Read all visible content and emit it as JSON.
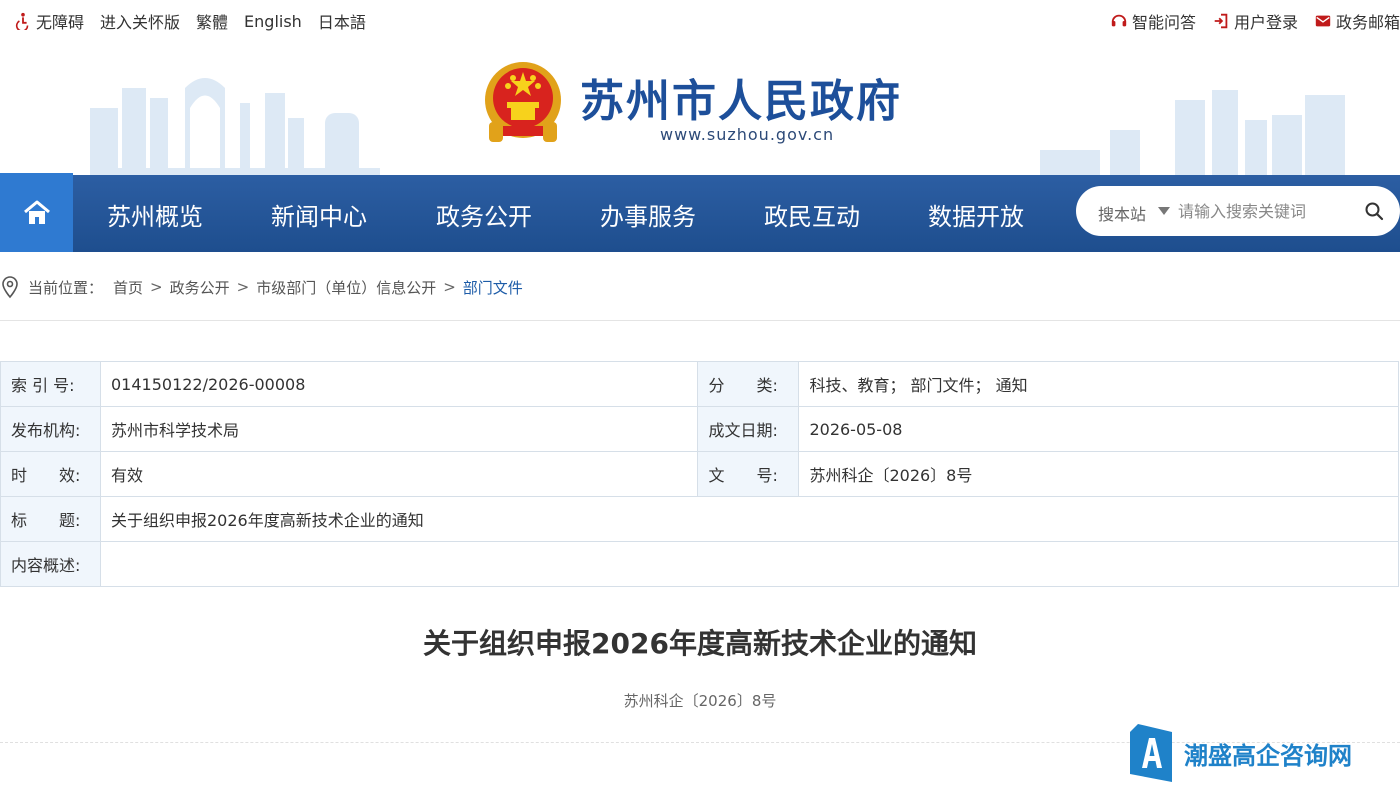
{
  "topbar": {
    "accessibility": "无障碍",
    "elder_mode": "进入关怀版",
    "traditional": "繁體",
    "english": "English",
    "japanese": "日本語",
    "smart_qa": "智能问答",
    "login": "用户登录",
    "mail": "政务邮箱"
  },
  "header": {
    "site_title": "苏州市人民政府",
    "site_url": "www.suzhou.gov.cn"
  },
  "nav": {
    "items": [
      "苏州概览",
      "新闻中心",
      "政务公开",
      "办事服务",
      "政民互动",
      "数据开放"
    ],
    "search_scope": "搜本站",
    "search_placeholder": "请输入搜索关键词"
  },
  "breadcrumb": {
    "label": "当前位置：",
    "items": [
      "首页",
      "政务公开",
      "市级部门（单位）信息公开",
      "部门文件"
    ],
    "separator": ">"
  },
  "meta": {
    "index_key": "索 引 号:",
    "index_val": "014150122/2026-00008",
    "category_key": "分　　类:",
    "category_val": "科技、教育；  部门文件；  通知",
    "publisher_key": "发布机构:",
    "publisher_val": "苏州市科学技术局",
    "date_key": "成文日期:",
    "date_val": "2026-05-08",
    "validity_key": "时　　效:",
    "validity_val": "有效",
    "docno_key": "文　　号:",
    "docno_val": "苏州科企〔2026〕8号",
    "title_key": "标　　题:",
    "title_val": "关于组织申报2026年度高新技术企业的通知",
    "summary_key": "内容概述:",
    "summary_val": ""
  },
  "article": {
    "title": "关于组织申报2026年度高新技术企业的通知",
    "doc_number": "苏州科企〔2026〕8号"
  },
  "watermark": {
    "text": "潮盛高企咨询网"
  },
  "colors": {
    "nav_bg": "#2457a0",
    "home_bg": "#2f7ad1",
    "title_blue": "#1d4f9a",
    "meta_key_bg": "#f0f6fc",
    "watermark_blue": "#1f82c9"
  }
}
